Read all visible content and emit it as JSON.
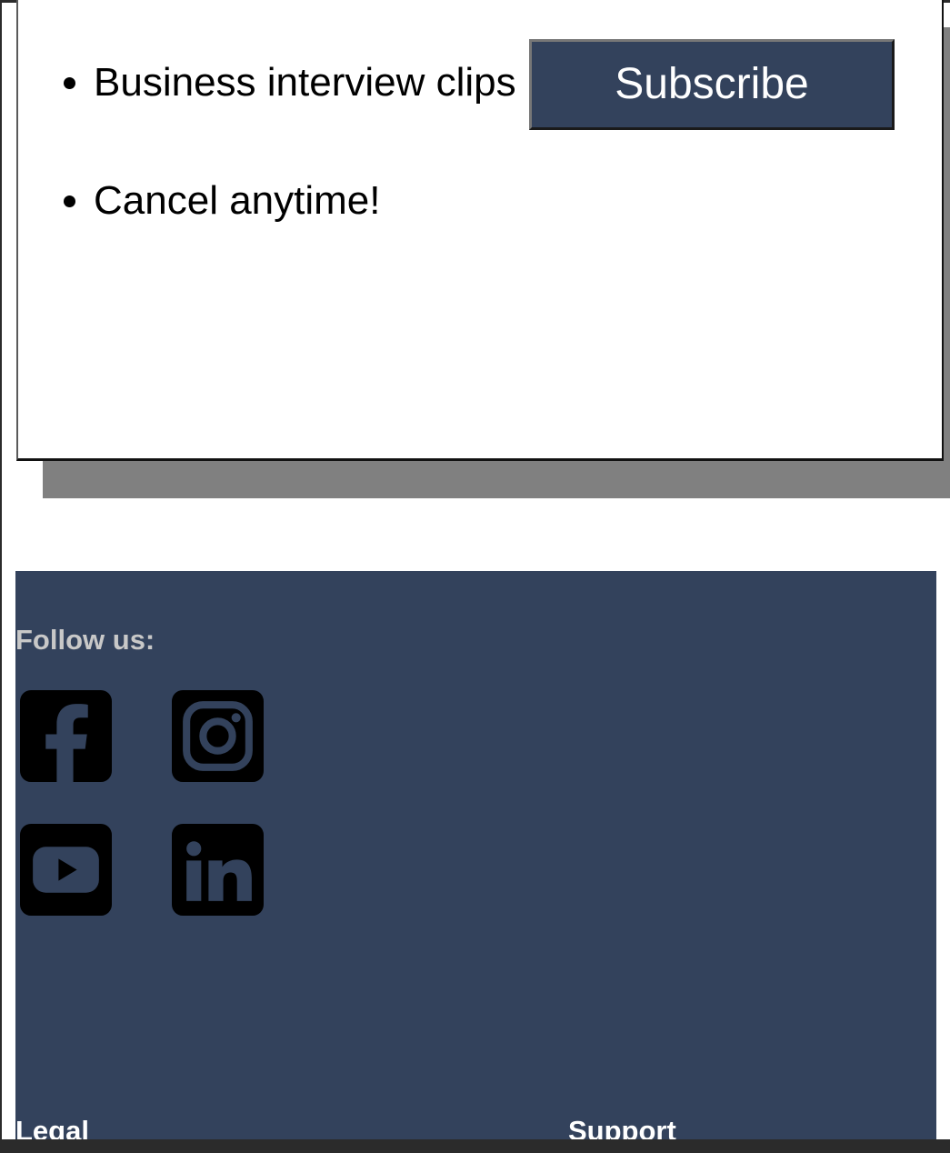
{
  "features": [
    "Business interview clips",
    "Cancel anytime!"
  ],
  "subscribe": {
    "label": "Subscribe"
  },
  "footer": {
    "follow_label": "Follow us:",
    "social": [
      {
        "name": "facebook",
        "icon": "facebook-icon"
      },
      {
        "name": "instagram",
        "icon": "instagram-icon"
      },
      {
        "name": "youtube",
        "icon": "youtube-icon"
      },
      {
        "name": "linkedin",
        "icon": "linkedin-icon"
      }
    ],
    "columns": {
      "legal": "Legal",
      "support": "Support"
    }
  },
  "colors": {
    "navy": "#33425c",
    "shadow": "#808080",
    "follow_text": "#c8c8c8"
  }
}
